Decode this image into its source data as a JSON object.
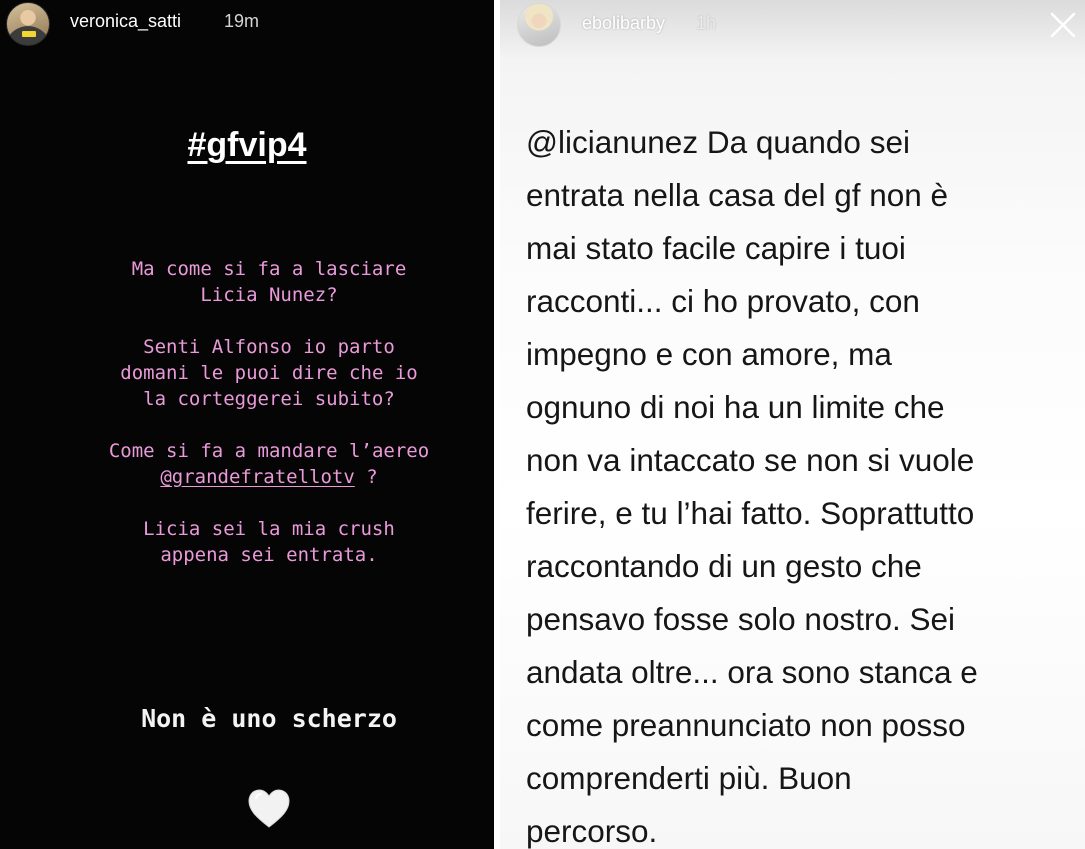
{
  "left_story": {
    "username": "veronica_satti",
    "time": "19m",
    "hashtag": "#gfvip4",
    "paragraphs": {
      "p1": "Ma come si fa a lasciare\nLicia Nunez?",
      "p2": "Senti Alfonso io parto\ndomani le puoi dire che io\nla corteggerei subito?",
      "p3_line1": "Come si fa a mandare l’aereo",
      "p3_mention": "@grandefratellotv",
      "p3_tail": " ?",
      "p4": "Licia sei la mia crush\nappena sei entrata."
    },
    "closing": "Non è uno scherzo",
    "heart_icon": "white-heart-icon",
    "colors": {
      "background": "#050505",
      "pink_text": "#e99ad9",
      "white_text": "#ffffff"
    }
  },
  "right_story": {
    "username": "ebolibarby",
    "time": "1h",
    "close_icon": "close-icon",
    "message": "@licianunez Da quando sei\nentrata nella casa del gf non è\nmai stato facile capire i tuoi\nracconti... ci ho provato, con\nimpegno e con amore, ma\nognuno di noi ha un limite che\nnon va intaccato se non si vuole\nferire, e tu l’hai fatto. Soprattutto\nraccontando di un gesto che\npensavo fosse solo nostro. Sei\nandata oltre... ora sono stanca e\ncome preannunciato non posso\ncomprenderti più. Buon\npercorso.",
    "colors": {
      "background": "#f7f7f7",
      "text": "#161616"
    }
  }
}
